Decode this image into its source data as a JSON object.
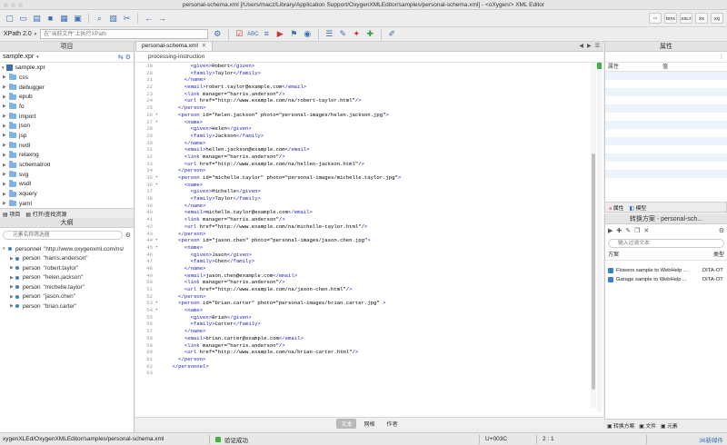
{
  "window": {
    "title": "personal-schema.xml [/Users/macz/Library/Application Support/OxygenXMLEditor/samples/personal-schema.xml] - <oXygen/> XML Editor"
  },
  "toolbar": {
    "xpath_label": "XPath 2.0",
    "xpath_placeholder": "在\"当前文件\"上执行XPath",
    "right_buttons": [
      "",
      "DITA",
      "XSLT",
      "XS",
      "XQ"
    ]
  },
  "project": {
    "panel_title": "项目",
    "project_file": "sample.xpr",
    "root": "sample.xpr",
    "folders": [
      "css",
      "debugger",
      "epub",
      "fo",
      "import",
      "json",
      "jsp",
      "nvdl",
      "relaxng",
      "schematron",
      "svg",
      "wsdl",
      "xquery",
      "yaml"
    ],
    "footer_tabs": [
      "项目",
      "打开/查找资源"
    ]
  },
  "outline": {
    "panel_title": "大纲",
    "filter_placeholder": "元素名称筛选器",
    "items": [
      {
        "name": "personnel",
        "value": "\"http://www.oxygenxml.com/ns/"
      },
      {
        "name": "person",
        "value": "\"harris.anderson\""
      },
      {
        "name": "person",
        "value": "\"robert.taylor\""
      },
      {
        "name": "person",
        "value": "\"helen.jackson\""
      },
      {
        "name": "person",
        "value": "\"michelle.taylor\""
      },
      {
        "name": "person",
        "value": "\"jason.chen\""
      },
      {
        "name": "person",
        "value": "\"brian.carter\""
      }
    ]
  },
  "editor": {
    "tab_label": "personal-schema.xml",
    "breadcrumb": "processing-instruction",
    "lines": [
      {
        "n": "19",
        "code": "          <given>Robert</given>"
      },
      {
        "n": "20",
        "code": "          <family>Taylor</family>"
      },
      {
        "n": "21",
        "code": "        </name>"
      },
      {
        "n": "22",
        "code": "        <email>robert.taylor@example.com</email>"
      },
      {
        "n": "23",
        "code": "        <link manager=\"harris.anderson\"/>"
      },
      {
        "n": "24",
        "code": "        <url href=\"http://www.example.com/na/robert-taylor.html\"/>"
      },
      {
        "n": "25",
        "code": "      </person>"
      },
      {
        "n": "26",
        "code": "      <person id=\"helen.jackson\" photo=\"personal-images/helen.jackson.jpg\">"
      },
      {
        "n": "27",
        "code": "        <name>"
      },
      {
        "n": "28",
        "code": "          <given>Helen</given>"
      },
      {
        "n": "29",
        "code": "          <family>Jackson</family>"
      },
      {
        "n": "30",
        "code": "        </name>"
      },
      {
        "n": "31",
        "code": "        <email>hellen.jackson@example.com</email>"
      },
      {
        "n": "32",
        "code": "        <link manager=\"harris.anderson\"/>"
      },
      {
        "n": "33",
        "code": "        <url href=\"http://www.example.com/na/hellen-jackson.html\"/>"
      },
      {
        "n": "34",
        "code": "      </person>"
      },
      {
        "n": "35",
        "code": "      <person id=\"michelle.taylor\" photo=\"personal-images/michelle.taylor.jpg\">"
      },
      {
        "n": "36",
        "code": "        <name>"
      },
      {
        "n": "37",
        "code": "          <given>Michelle</given>"
      },
      {
        "n": "38",
        "code": "          <family>Taylor</family>"
      },
      {
        "n": "39",
        "code": "        </name>"
      },
      {
        "n": "40",
        "code": "        <email>michelle.taylor@example.com</email>"
      },
      {
        "n": "41",
        "code": "        <link manager=\"harris.anderson\"/>"
      },
      {
        "n": "42",
        "code": "        <url href=\"http://www.example.com/na/michelle-taylor.html\"/>"
      },
      {
        "n": "43",
        "code": "      </person>"
      },
      {
        "n": "44",
        "code": "      <person id=\"jason.chen\" photo=\"personal-images/jason.chen.jpg\">"
      },
      {
        "n": "45",
        "code": "        <name>"
      },
      {
        "n": "46",
        "code": "          <given>Jason</given>"
      },
      {
        "n": "47",
        "code": "          <family>Chen</family>"
      },
      {
        "n": "48",
        "code": "        </name>"
      },
      {
        "n": "49",
        "code": "        <email>jason.chen@example.com</email>"
      },
      {
        "n": "50",
        "code": "        <link manager=\"harris.anderson\"/>"
      },
      {
        "n": "51",
        "code": "        <url href=\"http://www.example.com/na/jason-chen.html\"/>"
      },
      {
        "n": "52",
        "code": "      </person>"
      },
      {
        "n": "53",
        "code": "      <person id=\"brian.carter\" photo=\"personal-images/brian.carter.jpg\" >"
      },
      {
        "n": "54",
        "code": "        <name>"
      },
      {
        "n": "55",
        "code": "          <given>Brian</given>"
      },
      {
        "n": "56",
        "code": "          <family>Carter</family>"
      },
      {
        "n": "57",
        "code": "        </name>"
      },
      {
        "n": "58",
        "code": "        <email>brian.carter@example.com</email>"
      },
      {
        "n": "59",
        "code": "        <link manager=\"harris.anderson\"/>"
      },
      {
        "n": "60",
        "code": "        <url href=\"http://www.example.com/na/brian-carter.html\"/>"
      },
      {
        "n": "61",
        "code": "      </person>"
      },
      {
        "n": "62",
        "code": "    </personnel>"
      },
      {
        "n": "63",
        "code": ""
      }
    ],
    "modes": [
      "文本",
      "网格",
      "作者"
    ],
    "active_mode": "文本"
  },
  "properties": {
    "panel_title": "属性",
    "col_attr": "属性",
    "col_value": "值",
    "sub_tabs": [
      "属性",
      "模型"
    ]
  },
  "scenarios": {
    "panel_title": "转换方案 - personal-sch...",
    "filter_placeholder": "输入过滤文本",
    "col_scenario": "方案",
    "col_type": "类型",
    "rows": [
      {
        "name": "Flowers sample to WebHelp ...",
        "type": "DITA-OT"
      },
      {
        "name": "Garage sample to WebHelp ...",
        "type": "DITA-OT"
      }
    ],
    "bottom_tabs": [
      "转换方案",
      "文件",
      "元素"
    ]
  },
  "status": {
    "path": "xygenXLEd/OxygenXMLEditor/samples/personal-schema.xml",
    "validation": "验证成功",
    "unicode": "U+003C",
    "position": "2 : 1",
    "updates": "36新邮件"
  },
  "colors": {
    "accent": "#3a6fb0",
    "tag": "#1b1bb5",
    "attr_name": "#8d2fb3",
    "attr_value": "#1a7a1a",
    "success": "#3fb33f"
  }
}
